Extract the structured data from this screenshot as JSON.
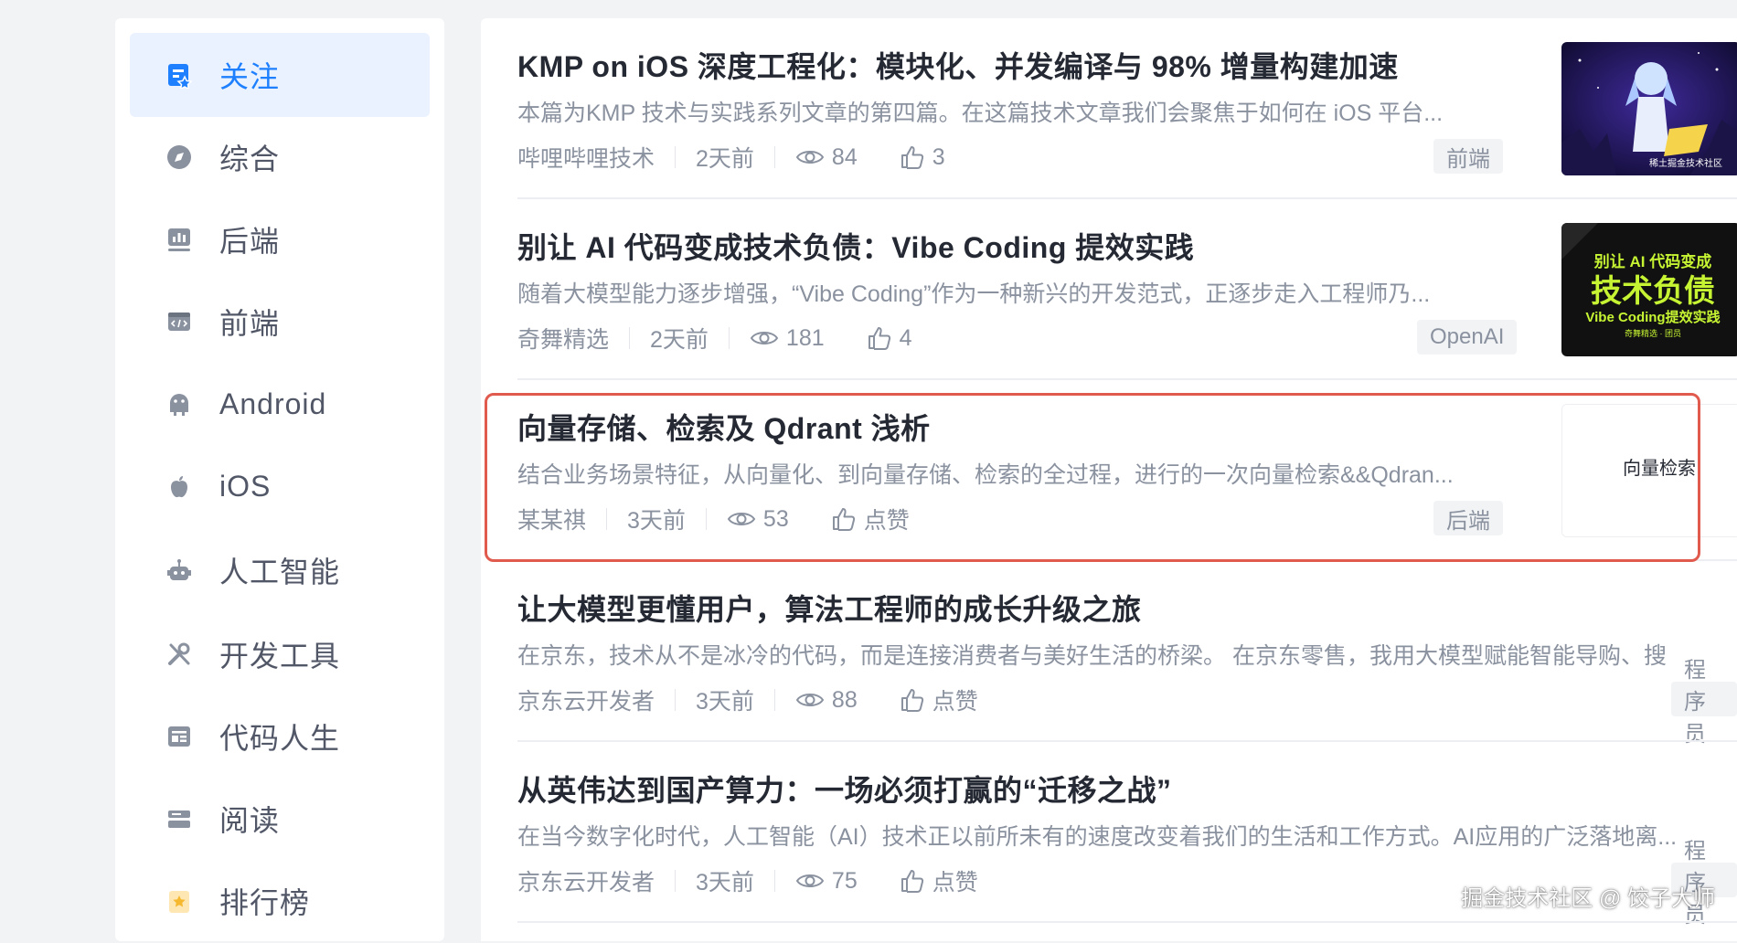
{
  "sidebar": {
    "items": [
      {
        "label": "关注",
        "icon": "follow-icon",
        "active": true
      },
      {
        "label": "综合",
        "icon": "compass-icon"
      },
      {
        "label": "后端",
        "icon": "backend-icon"
      },
      {
        "label": "前端",
        "icon": "frontend-icon"
      },
      {
        "label": "Android",
        "icon": "android-icon"
      },
      {
        "label": "iOS",
        "icon": "apple-icon"
      },
      {
        "label": "人工智能",
        "icon": "robot-icon"
      },
      {
        "label": "开发工具",
        "icon": "tools-icon"
      },
      {
        "label": "代码人生",
        "icon": "code-life-icon"
      },
      {
        "label": "阅读",
        "icon": "reading-icon"
      },
      {
        "label": "排行榜",
        "icon": "ranking-icon"
      }
    ],
    "active_color": "#1e80ff"
  },
  "articles": [
    {
      "title": "KMP on iOS 深度工程化：模块化、并发编译与 98% 增量构建加速",
      "abstract": "本篇为KMP 技术与实践系列文章的第四篇。在这篇技术文章我们会聚焦于如何在 iOS 平台...",
      "author": "哔哩哔哩技术",
      "time": "2天前",
      "views": "84",
      "likes": "3",
      "tag": "前端",
      "thumb_text": "稀土掘金技术社区"
    },
    {
      "title": "别让 AI 代码变成技术负债：Vibe Coding 提效实践",
      "abstract": "随着大模型能力逐步增强，“Vibe Coding”作为一种新兴的开发范式，正逐步走入工程师乃...",
      "author": "奇舞精选",
      "time": "2天前",
      "views": "181",
      "likes": "4",
      "tag": "OpenAI",
      "thumb_line1": "别让 AI 代码变成",
      "thumb_line2": "技术负债",
      "thumb_line3": "Vibe Coding提效实践",
      "thumb_line4": "奇舞精选 · 团员"
    },
    {
      "title": "向量存储、检索及 Qdrant 浅析",
      "abstract": "结合业务场景特征，从向量化、到向量存储、检索的全过程，进行的一次向量检索&&Qdran...",
      "author": "某某祺",
      "time": "3天前",
      "views": "53",
      "likes": "点赞",
      "tag": "后端",
      "thumb_text": "向量检索"
    },
    {
      "title": "让大模型更懂用户，算法工程师的成长升级之旅",
      "abstract": "在京东，技术从不是冰冷的代码，而是连接消费者与美好生活的桥梁。 在京东零售，我用大模型赋能智能导购、搜",
      "author": "京东云开发者",
      "time": "3天前",
      "views": "88",
      "likes": "点赞",
      "tag": "程序员"
    },
    {
      "title": "从英伟达到国产算力：一场必须打赢的“迁移之战”",
      "abstract": "在当今数字化时代，人工智能（AI）技术正以前所未有的速度改变着我们的生活和工作方式。AI应用的广泛落地离...",
      "author": "京东云开发者",
      "time": "3天前",
      "views": "75",
      "likes": "点赞",
      "tag": "程序员"
    }
  ],
  "watermark": "掘金技术社区 @ 饺子大师",
  "highlight_color": "#e05a4e"
}
